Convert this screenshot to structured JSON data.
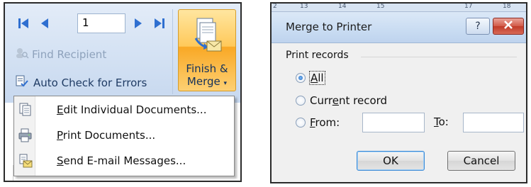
{
  "ribbon": {
    "record_value": "1",
    "find_recipient_label": "Find Recipient",
    "auto_check_label": "Auto Check for Errors",
    "finish_merge_line1": "Finish &",
    "finish_merge_line2": "Merge",
    "finish_merge_arrow": "▾",
    "nav_icons": [
      "first-record-icon",
      "previous-record-icon",
      "next-record-icon",
      "last-record-icon"
    ]
  },
  "dropdown_menu": {
    "items": [
      {
        "pre": "",
        "accel": "E",
        "post": "dit Individual Documents...",
        "icon": "edit-documents-icon"
      },
      {
        "pre": "",
        "accel": "P",
        "post": "rint Documents...",
        "icon": "print-documents-icon"
      },
      {
        "pre": "",
        "accel": "S",
        "post": "end E-mail Messages...",
        "icon": "send-email-icon"
      }
    ]
  },
  "ruler": {
    "marks": [
      "2",
      "13",
      "14",
      "15",
      "17",
      "18"
    ]
  },
  "dialog": {
    "title": "Merge to Printer",
    "help_glyph": "?",
    "group_label": "Print records",
    "radio_all": {
      "pre": "",
      "accel": "A",
      "post": "ll",
      "checked": true
    },
    "radio_current": {
      "pre": "Curr",
      "accel": "e",
      "post": "nt record",
      "checked": false
    },
    "radio_from": {
      "pre": "",
      "accel": "F",
      "post": "rom:",
      "checked": false
    },
    "from_value": "",
    "to_label_accel": "T",
    "to_label_post": "o:",
    "to_value": "",
    "ok_label": "OK",
    "cancel_label": "Cancel"
  },
  "colors": {
    "ribbon_blue": "#d3e1f3",
    "finish_orange": "#f9a825",
    "close_red": "#c13b28",
    "nav_blue": "#2f6fd0"
  }
}
